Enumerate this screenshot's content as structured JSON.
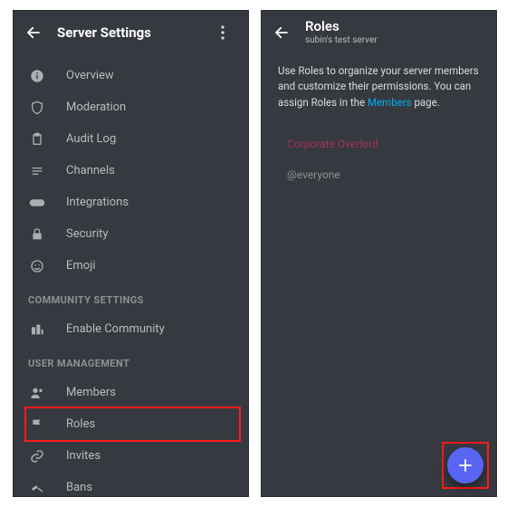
{
  "left": {
    "title": "Server Settings",
    "items": [
      {
        "label": "Overview"
      },
      {
        "label": "Moderation"
      },
      {
        "label": "Audit Log"
      },
      {
        "label": "Channels"
      },
      {
        "label": "Integrations"
      },
      {
        "label": "Security"
      },
      {
        "label": "Emoji"
      }
    ],
    "section_community": "Community Settings",
    "community_item": "Enable Community",
    "section_user_mgmt": "User Management",
    "user_mgmt": {
      "members": "Members",
      "roles": "Roles",
      "invites": "Invites",
      "bans": "Bans"
    }
  },
  "right": {
    "title": "Roles",
    "subtitle": "subin's test server",
    "desc_pre": "Use Roles to organize your server members and customize their permissions. You can assign Roles in the ",
    "desc_link": "Members",
    "desc_post": " page.",
    "roles": [
      {
        "name": "Corporate Overlord"
      },
      {
        "name": "@everyone"
      }
    ],
    "fab_plus": "+"
  }
}
